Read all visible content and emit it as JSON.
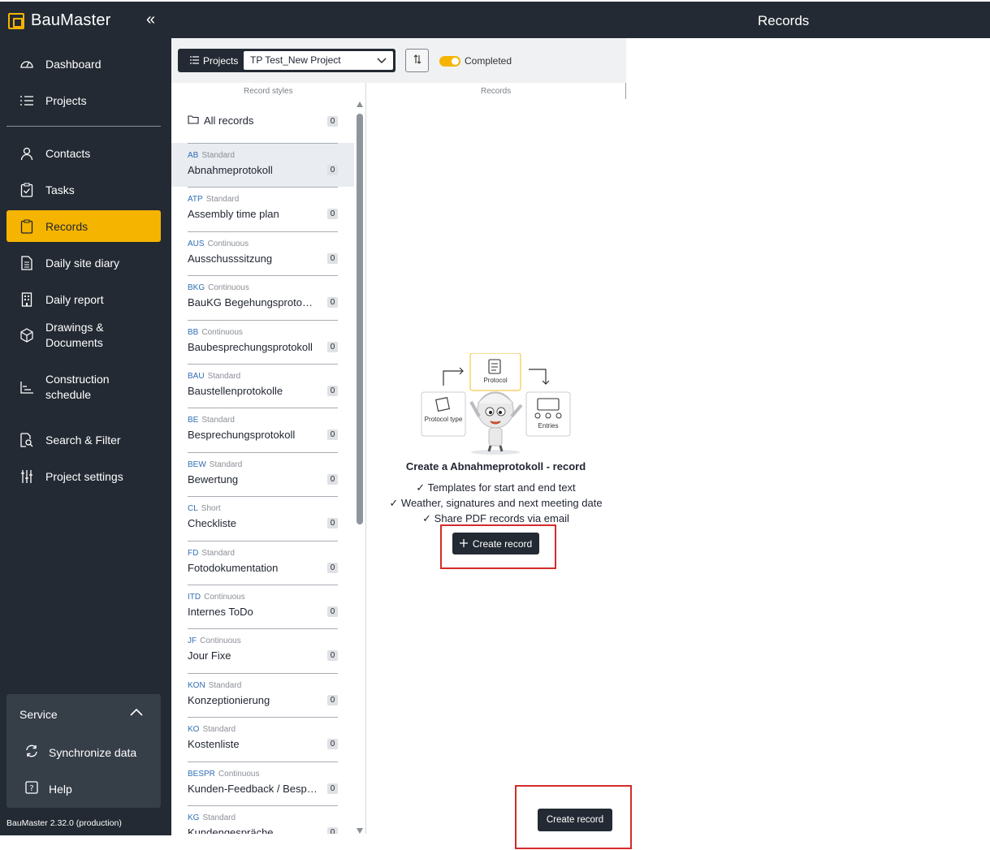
{
  "app": {
    "name": "BauMaster",
    "page_title": "Records",
    "version": "BauMaster 2.32.0 (production)"
  },
  "nav": [
    {
      "label": "Dashboard",
      "icon": "gauge-icon"
    },
    {
      "label": "Projects",
      "icon": "list-icon"
    },
    {
      "label": "Contacts",
      "icon": "person-icon"
    },
    {
      "label": "Tasks",
      "icon": "clipboard-check-icon"
    },
    {
      "label": "Records",
      "icon": "clipboard-icon",
      "active": true
    },
    {
      "label": "Daily site diary",
      "icon": "document-icon"
    },
    {
      "label": "Daily report",
      "icon": "building-icon"
    },
    {
      "label": "Drawings & Documents",
      "icon": "cube-icon"
    },
    {
      "label": "Construction schedule",
      "icon": "gantt-icon"
    },
    {
      "label": "Search & Filter",
      "icon": "search-document-icon"
    },
    {
      "label": "Project settings",
      "icon": "sliders-icon"
    }
  ],
  "service": {
    "title": "Service",
    "items": [
      {
        "label": "Synchronize data",
        "icon": "sync-icon"
      },
      {
        "label": "Help",
        "icon": "help-icon"
      }
    ]
  },
  "toolbar": {
    "projects_label": "Projects",
    "project_value": "TP Test_New Project",
    "toggle_label": "Completed"
  },
  "columns": {
    "record_styles": "Record styles",
    "records": "Records"
  },
  "all_records": {
    "label": "All records",
    "count": "0"
  },
  "record_styles": [
    {
      "code": "AB",
      "type": "Standard",
      "name": "Abnahmeprotokoll",
      "count": "0",
      "selected": true
    },
    {
      "code": "ATP",
      "type": "Standard",
      "name": "Assembly time plan",
      "count": "0"
    },
    {
      "code": "AUS",
      "type": "Continuous",
      "name": "Ausschusssitzung",
      "count": "0"
    },
    {
      "code": "BKG",
      "type": "Continuous",
      "name": "BauKG Begehungsprotokoll",
      "count": "0"
    },
    {
      "code": "BB",
      "type": "Continuous",
      "name": "Baubesprechungsprotokoll",
      "count": "0"
    },
    {
      "code": "BAU",
      "type": "Standard",
      "name": "Baustellenprotokolle",
      "count": "0"
    },
    {
      "code": "BE",
      "type": "Standard",
      "name": "Besprechungsprotokoll",
      "count": "0"
    },
    {
      "code": "BEW",
      "type": "Standard",
      "name": "Bewertung",
      "count": "0"
    },
    {
      "code": "CL",
      "type": "Short",
      "name": "Checkliste",
      "count": "0"
    },
    {
      "code": "FD",
      "type": "Standard",
      "name": "Fotodokumentation",
      "count": "0"
    },
    {
      "code": "ITD",
      "type": "Continuous",
      "name": "Internes ToDo",
      "count": "0"
    },
    {
      "code": "JF",
      "type": "Continuous",
      "name": "Jour Fixe",
      "count": "0"
    },
    {
      "code": "KON",
      "type": "Standard",
      "name": "Konzeptionierung",
      "count": "0"
    },
    {
      "code": "KO",
      "type": "Standard",
      "name": "Kostenliste",
      "count": "0"
    },
    {
      "code": "BESPR",
      "type": "Continuous",
      "name": "Kunden-Feedback / Besprechung",
      "count": "0"
    },
    {
      "code": "KG",
      "type": "Standard",
      "name": "Kundengespräche",
      "count": "0"
    }
  ],
  "empty_state": {
    "title": "Create a Abnahmeprotokoll - record",
    "features": [
      "Templates for start and end text",
      "Weather, signatures and next meeting date",
      "Share PDF records via email"
    ],
    "illustration_labels": {
      "protocol": "Protocol",
      "protocol_type": "Protocol type",
      "entries": "Entries"
    },
    "create_button": "Create record"
  },
  "footer_button": "Create record",
  "colors": {
    "accent": "#f5b400",
    "sidebar": "#232a33",
    "highlight": "#d42b2b"
  }
}
